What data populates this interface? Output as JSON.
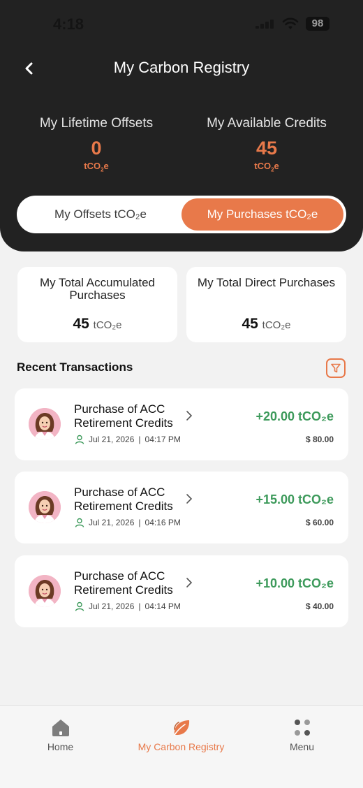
{
  "status_bar": {
    "time": "4:18",
    "battery": "98"
  },
  "header": {
    "title": "My Carbon Registry",
    "stats": [
      {
        "label": "My Lifetime Offsets",
        "value": "0",
        "unit": "tCO",
        "unit_sub": "2",
        "unit_suffix": "e"
      },
      {
        "label": "My Available Credits",
        "value": "45",
        "unit": "tCO",
        "unit_sub": "2",
        "unit_suffix": "e"
      }
    ]
  },
  "toggle": {
    "options": [
      "My Offsets tCO₂e",
      "My Purchases tCO₂e"
    ],
    "selected": "My Purchases tCO₂e"
  },
  "summary": [
    {
      "label": "My Total Accumulated Purchases",
      "value": "45",
      "unit": "tCO₂e"
    },
    {
      "label": "My Total Direct Purchases",
      "value": "45",
      "unit": "tCO₂e"
    }
  ],
  "recent": {
    "title": "Recent Transactions",
    "items": [
      {
        "title": "Purchase of ACC Retirement Credits",
        "date": "Jul 21, 2026",
        "time": "04:17 PM",
        "amount": "+20.00 tCO₂e",
        "price": "$ 80.00"
      },
      {
        "title": "Purchase of ACC Retirement Credits",
        "date": "Jul 21, 2026",
        "time": "04:16 PM",
        "amount": "+15.00 tCO₂e",
        "price": "$ 60.00"
      },
      {
        "title": "Purchase of ACC Retirement Credits",
        "date": "Jul 21, 2026",
        "time": "04:14 PM",
        "amount": "+10.00 tCO₂e",
        "price": "$ 40.00"
      }
    ]
  },
  "nav": {
    "items": [
      {
        "label": "Home",
        "icon": "home-icon"
      },
      {
        "label": "My Carbon Registry",
        "icon": "leaf-icon"
      },
      {
        "label": "Menu",
        "icon": "menu-dots-icon"
      }
    ],
    "active": "My Carbon Registry"
  },
  "colors": {
    "accent": "#e8794a",
    "positive": "#3d9a5b",
    "header_bg": "#222222"
  }
}
